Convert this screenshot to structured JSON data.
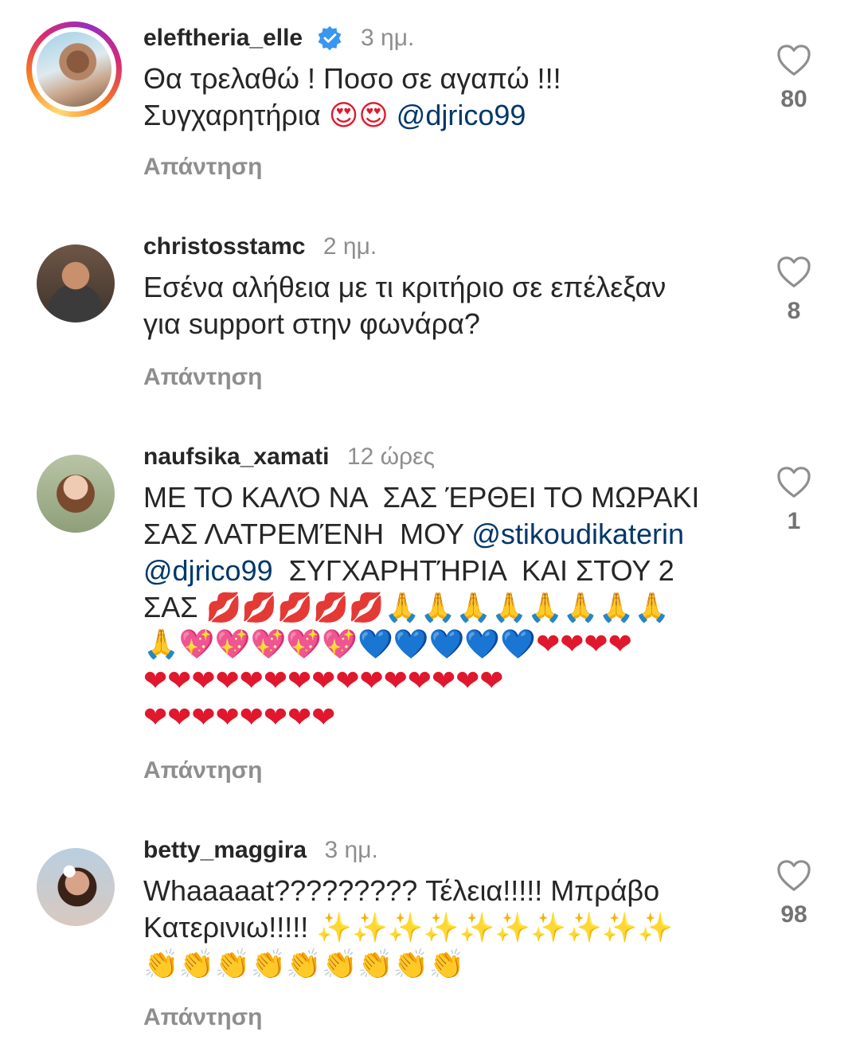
{
  "comments": [
    {
      "username": "eleftheria_elle",
      "time": "3 ημ.",
      "line1": "Θα τρελαθώ ! Ποσο σε αγαπώ !!!",
      "line2": "Συγχαρητήρια ",
      "emojis": "😍😍",
      "mention": "@djrico99",
      "reply": "Απάντηση",
      "likes": "80"
    },
    {
      "username": "christosstamc",
      "time": "2 ημ.",
      "line1": "Εσένα αλήθεια με τι κριτήριο σε επέλεξαν",
      "line2": "για support στην φωνάρα?",
      "reply": "Απάντηση",
      "likes": "8"
    },
    {
      "username": "naufsika_xamati",
      "time": "12 ώρες",
      "line1": "ΜΕ ΤΟ ΚΑΛΌ ΝΑ  ΣΑΣ ΈΡΘΕΙ ΤΟ ΜΩΡΑΚΙ",
      "line2": "ΣΑΣ ΛΑΤΡΕΜΈΝΗ  ΜΟΥ ",
      "mention1": "@stikoudikaterin",
      "mention2": "@djrico99",
      "line3": "  ΣΥΓΧΑΡΗΤΉΡΙΑ  ΚΑΙ ΣΤΟΥ 2",
      "line4": "ΣΑΣ ",
      "lips": "💋💋💋💋💋",
      "pray1": "🙏🙏🙏🙏🙏🙏🙏🙏",
      "pray2": "🙏",
      "sparkle_hearts": "💖💖💖💖💖",
      "blue_hearts": "💙💙💙💙💙",
      "red_hearts_a": "❤❤❤❤",
      "red_hearts_b": "❤❤❤❤❤❤❤❤❤❤❤❤❤❤❤",
      "red_hearts_c": "❤❤❤❤❤❤❤❤",
      "reply": "Απάντηση",
      "likes": "1"
    },
    {
      "username": "betty_maggira",
      "time": "3 ημ.",
      "line1": "Whaaaaat????????? Τέλεια!!!!! Μπράβο",
      "line2": "Κατερινιω!!!!! ",
      "sparkles": "✨✨✨✨✨✨✨✨✨✨",
      "clap": "👏👏👏👏👏👏👏👏👏",
      "reply": "Απάντηση",
      "likes": "98"
    }
  ],
  "colors": {
    "text": "#262626",
    "secondary": "#8e8e8e",
    "mention": "#00376b",
    "verified": "#3897f0"
  },
  "icons": {
    "like": "heart-outline-icon",
    "verified": "verified-badge-icon"
  }
}
